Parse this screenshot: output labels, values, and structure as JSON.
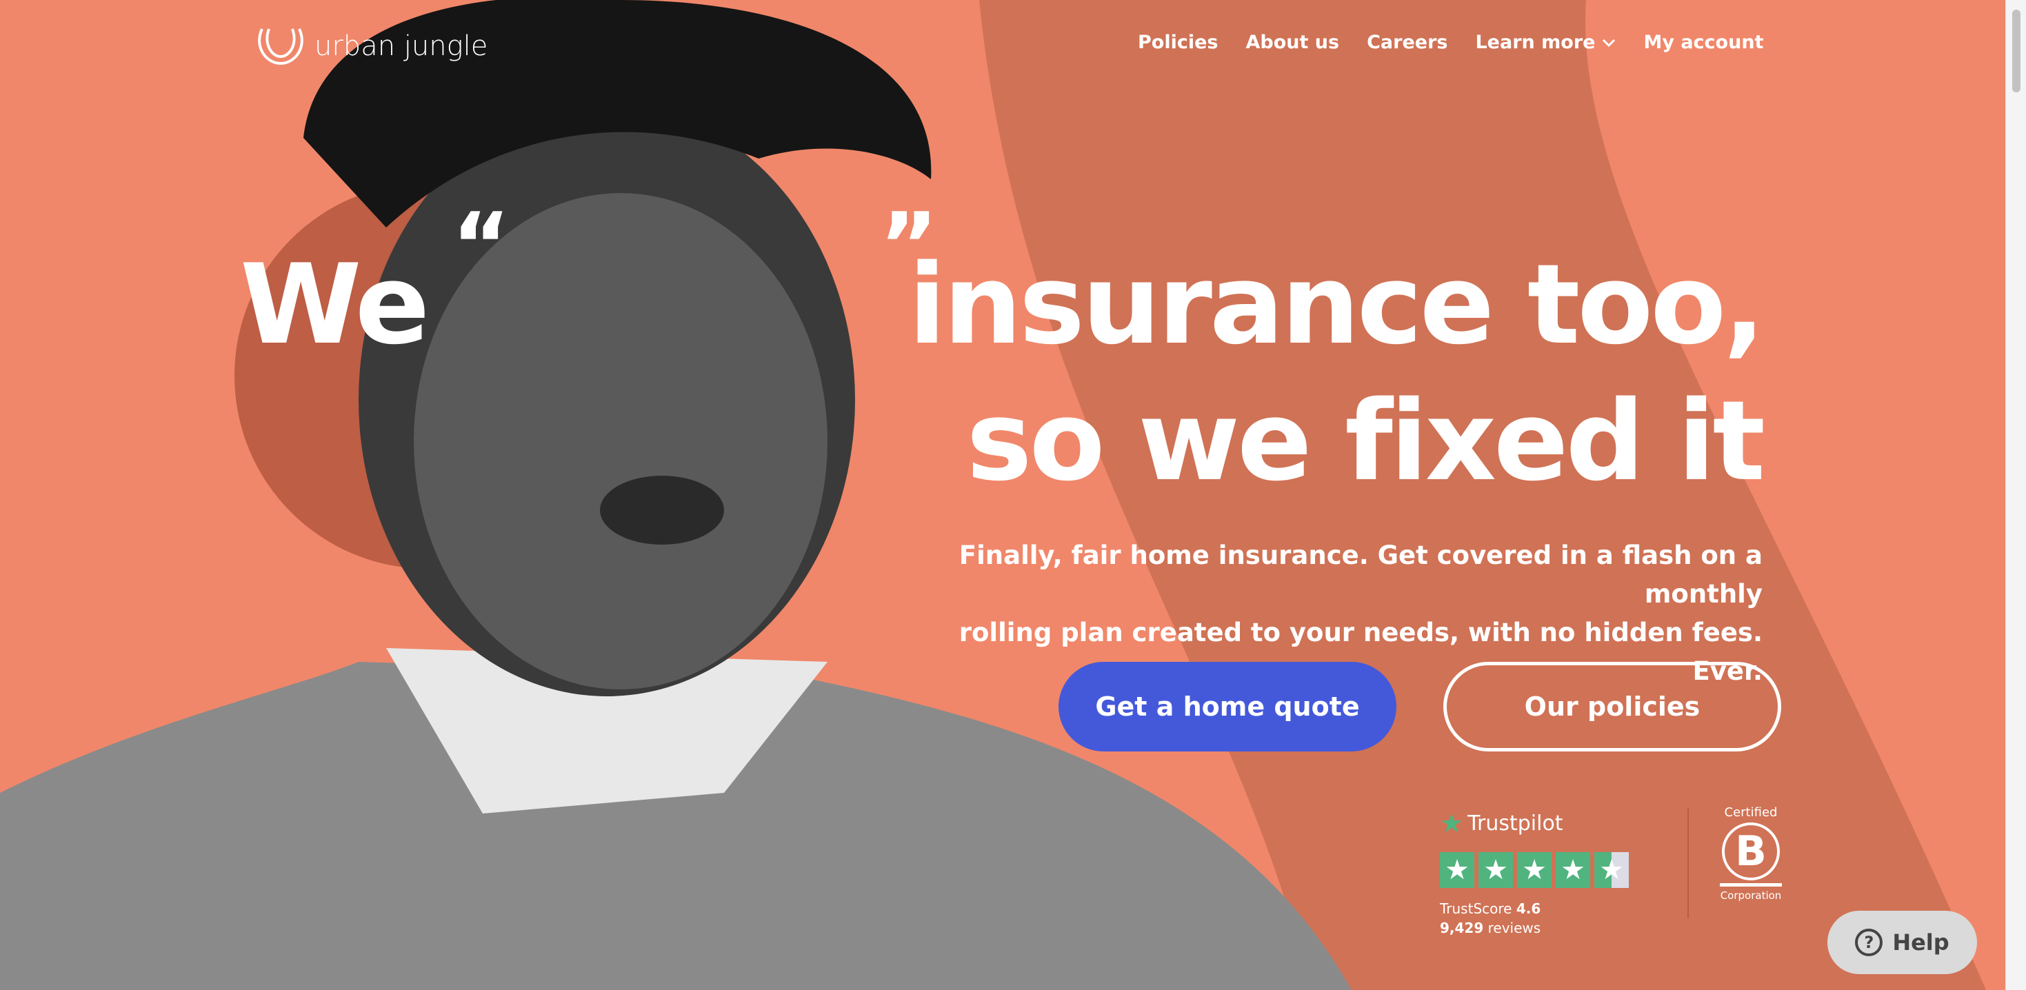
{
  "brand": {
    "name": "urban jungle"
  },
  "nav": {
    "items": [
      "Policies",
      "About us",
      "Careers",
      "Learn more",
      "My account"
    ]
  },
  "hero": {
    "word_we": "We",
    "open_quote": "“",
    "close_quote": "”",
    "line1": "insurance too,",
    "line2": "so we fixed it",
    "subtitle_line1": "Finally, fair home insurance. Get covered in a flash on a monthly",
    "subtitle_line2": "rolling plan created to your needs, with no hidden fees. Ever.",
    "primary_button": "Get a home quote",
    "secondary_button": "Our policies"
  },
  "trustpilot": {
    "name": "Trustpilot",
    "score_label": "TrustScore",
    "score": "4.6",
    "reviews_count": "9,429",
    "reviews_label": "reviews",
    "rating": 4.6
  },
  "bcorp": {
    "top": "Certified",
    "letter": "B",
    "bottom": "Corporation"
  },
  "help": {
    "label": "Help"
  },
  "colors": {
    "background": "#F0876A",
    "band": "#D07255",
    "primary": "#4459DA",
    "trustpilot": "#51B47F"
  }
}
